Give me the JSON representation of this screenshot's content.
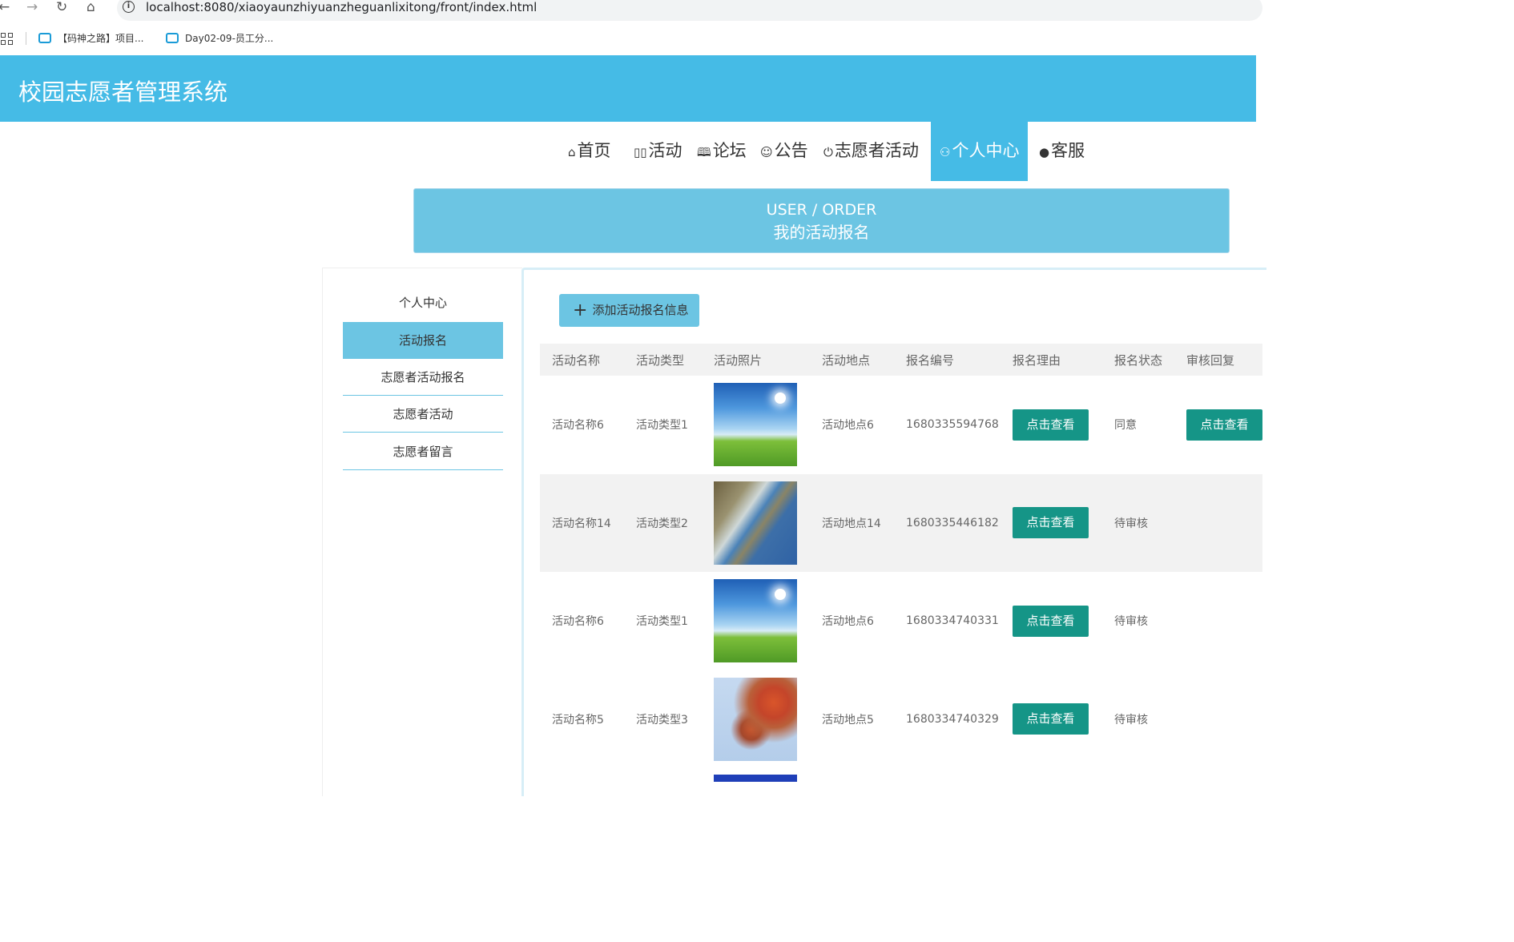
{
  "browser": {
    "url": "localhost:8080/xiaoyaunzhiyuanzheguanlixitong/front/index.html",
    "bookmarks": [
      "【码神之路】项目...",
      "Day02-09-员工分..."
    ]
  },
  "header": {
    "title": "校园志愿者管理系统"
  },
  "nav": {
    "items": [
      {
        "label": "首页",
        "icon": "home-icon"
      },
      {
        "label": "活动",
        "icon": "activity-icon"
      },
      {
        "label": "论坛",
        "icon": "forum-icon"
      },
      {
        "label": "公告",
        "icon": "notice-icon"
      },
      {
        "label": "志愿者活动",
        "icon": "power-icon"
      },
      {
        "label": "个人中心",
        "icon": "user-icon"
      },
      {
        "label": "客服",
        "icon": "chat-icon"
      }
    ],
    "active": "个人中心",
    "active_color": "#45bbe6"
  },
  "banner": {
    "en": "USER / ORDER",
    "cn": "我的活动报名"
  },
  "sidebar": {
    "title": "个人中心",
    "items": [
      "活动报名",
      "志愿者活动报名",
      "志愿者活动",
      "志愿者留言"
    ],
    "active": "活动报名"
  },
  "content": {
    "add_button": "添加活动报名信息",
    "columns": [
      "活动名称",
      "活动类型",
      "活动照片",
      "活动地点",
      "报名编号",
      "报名理由",
      "报名状态",
      "审核回复"
    ],
    "rows": [
      {
        "name": "活动名称6",
        "type": "活动类型1",
        "photo": "sky-meadow",
        "place": "活动地点6",
        "no": "1680335594768",
        "reason": "点击查看",
        "status": "同意",
        "reply": "点击查看"
      },
      {
        "name": "活动名称14",
        "type": "活动类型2",
        "photo": "coastline",
        "place": "活动地点14",
        "no": "1680335446182",
        "reason": "点击查看",
        "status": "待审核",
        "reply": ""
      },
      {
        "name": "活动名称6",
        "type": "活动类型1",
        "photo": "sky-meadow",
        "place": "活动地点6",
        "no": "1680334740331",
        "reason": "点击查看",
        "status": "待审核",
        "reply": ""
      },
      {
        "name": "活动名称5",
        "type": "活动类型3",
        "photo": "autumn-leaves",
        "place": "活动地点5",
        "no": "1680334740329",
        "reason": "点击查看",
        "status": "待审核",
        "reply": ""
      }
    ],
    "button_color": "#159587"
  }
}
